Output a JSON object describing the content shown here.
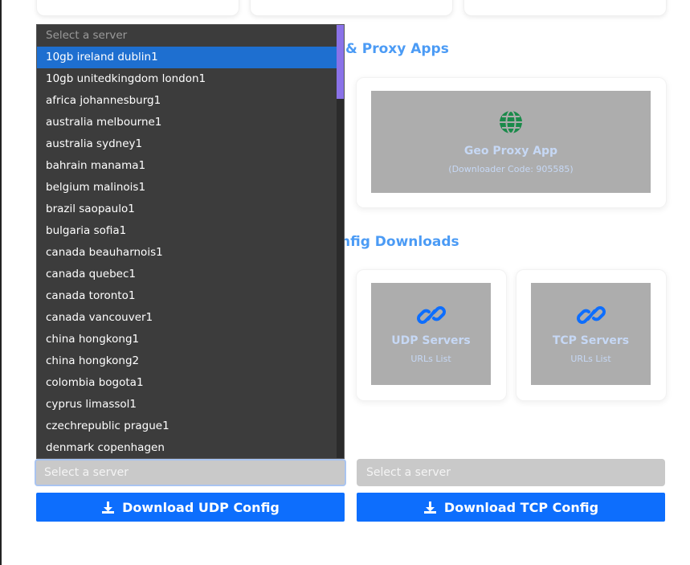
{
  "sections": {
    "proxy_apps_title": "& Proxy Apps",
    "config_downloads_title": "nfig Downloads"
  },
  "geo_proxy": {
    "icon": "globe-icon",
    "title": "Geo Proxy App",
    "subtitle": "(Downloader Code: 905585)"
  },
  "udp_tile": {
    "icon": "link-icon",
    "title": "UDP Servers",
    "subtitle": "URLs List"
  },
  "tcp_tile": {
    "icon": "link-icon",
    "title": "TCP Servers",
    "subtitle": "URLs List"
  },
  "udp_select": {
    "value": "Select a server"
  },
  "tcp_select": {
    "value": "Select a server"
  },
  "udp_button": {
    "label": "Download UDP Config",
    "icon": "download-icon"
  },
  "tcp_button": {
    "label": "Download TCP Config",
    "icon": "download-icon"
  },
  "dropdown": {
    "placeholder": "Select a server",
    "selected_index": 0,
    "options": [
      "10gb ireland dublin1",
      "10gb unitedkingdom london1",
      "africa johannesburg1",
      "australia melbourne1",
      "australia sydney1",
      "bahrain manama1",
      "belgium malinois1",
      "brazil saopaulo1",
      "bulgaria sofia1",
      "canada beauharnois1",
      "canada quebec1",
      "canada toronto1",
      "canada vancouver1",
      "china hongkong1",
      "china hongkong2",
      "colombia bogota1",
      "cyprus limassol1",
      "czechrepublic prague1",
      "denmark copenhagen"
    ]
  },
  "colors": {
    "accent": "#0d6efd",
    "section_title": "#4b9bf5",
    "tile_bg": "#adadad",
    "dropdown_bg": "#3c3c3c",
    "dropdown_selected": "#1e6fd0",
    "globe": "#1a8a4a"
  }
}
